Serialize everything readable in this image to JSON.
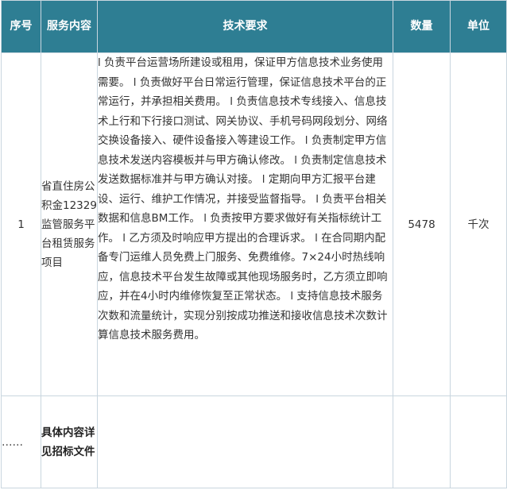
{
  "headers": {
    "seq": "序号",
    "name": "服务内容",
    "tech": "技术要求",
    "qty": "数量",
    "unit": "单位"
  },
  "rows": [
    {
      "seq": "1",
      "name": "省直住房公积金12329监管服务平台租赁服务项目",
      "tech": "l 负责平台运营场所建设或租用，保证甲方信息技术业务使用需要。 l 负责做好平台日常运行管理，保证信息技术平台的正常运行，并承担相关费用。 l 负责信息技术专线接入、信息技术上行和下行接口测试、网关协议、手机号码网段划分、网络交换设备接入、硬件设备接入等建设工作。 l 负责制定甲方信息技术发送内容模板并与甲方确认修改。 l 负责制定信息技术发送数据标准并与甲方确认对接。 l 定期向甲方汇报平台建设、运行、维护工作情况，并接受监督指导。 l 负责平台相关数据和信息BM工作。 l 负责按甲方要求做好有关指标统计工作。 l 乙方须及时响应甲方提出的合理诉求。 l 在合同期内配备专门运维人员免费上门服务、免费维修。7×24小时热线响应，信息技术平台发生故障或其他现场服务时，乙方须立即响应，并在4小时内维修恢复至正常状态。 l 支持信息技术服务次数和流量统计，实现分别按成功推送和接收信息技术次数计算信息技术服务费用。",
      "qty": "5478",
      "unit": "千次"
    },
    {
      "seq": "……",
      "name": "具体内容详见招标文件",
      "tech": "",
      "qty": "",
      "unit": ""
    }
  ]
}
